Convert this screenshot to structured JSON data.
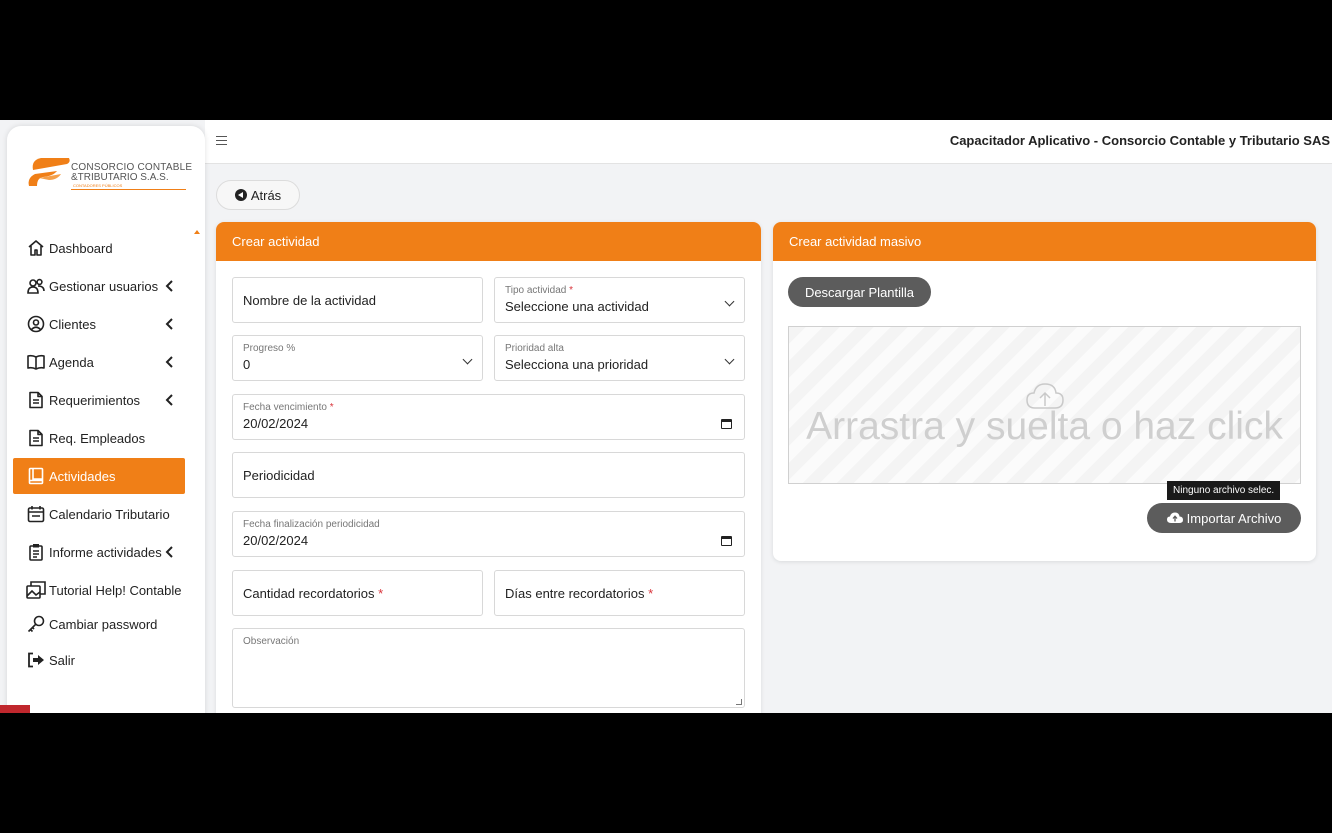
{
  "app": {
    "title": "Capacitador Aplicativo - Consorcio Contable y Tributario SAS"
  },
  "logo": {
    "line1": "CONSORCIO CONTABLE",
    "line2": "&TRIBUTARIO S.A.S.",
    "line3": "CONTADORES PÚBLICOS"
  },
  "sidebar": {
    "items": [
      {
        "label": "Dashboard",
        "icon": "home-icon",
        "has_chevron": false,
        "active": false
      },
      {
        "label": "Gestionar usuarios",
        "icon": "users-icon",
        "has_chevron": true,
        "active": false
      },
      {
        "label": "Clientes",
        "icon": "user-circle-icon",
        "has_chevron": true,
        "active": false
      },
      {
        "label": "Agenda",
        "icon": "book-open-icon",
        "has_chevron": true,
        "active": false
      },
      {
        "label": "Requerimientos",
        "icon": "document-icon",
        "has_chevron": true,
        "active": false
      },
      {
        "label": "Req. Empleados",
        "icon": "document-icon",
        "has_chevron": false,
        "active": false
      },
      {
        "label": "Actividades",
        "icon": "book-icon",
        "has_chevron": false,
        "active": true
      },
      {
        "label": "Calendario Tributario",
        "icon": "calendar-icon",
        "has_chevron": false,
        "active": false
      },
      {
        "label": "Informe actividades",
        "icon": "report-icon",
        "has_chevron": true,
        "active": false
      },
      {
        "label": "Tutorial Help! Contable",
        "icon": "images-icon",
        "has_chevron": false,
        "active": false
      },
      {
        "label": "Cambiar password",
        "icon": "key-icon",
        "has_chevron": false,
        "active": false
      },
      {
        "label": "Salir",
        "icon": "logout-icon",
        "has_chevron": false,
        "active": false
      }
    ]
  },
  "back_button": {
    "label": "Atrás"
  },
  "create_form": {
    "header": "Crear actividad",
    "nombre_placeholder": "Nombre de la actividad",
    "tipo_label": "Tipo actividad",
    "tipo_value": "Seleccione una actividad",
    "progreso_label": "Progreso %",
    "progreso_value": "0",
    "prioridad_label": "Prioridad alta",
    "prioridad_value": "Selecciona una prioridad",
    "fecha_venc_label": "Fecha vencimiento",
    "fecha_venc_value": "20/02/2024",
    "periodicidad_placeholder": "Periodicidad",
    "fecha_fin_label": "Fecha finalización periodicidad",
    "fecha_fin_value": "20/02/2024",
    "cantidad_placeholder": "Cantidad recordatorios",
    "dias_placeholder": "Días entre recordatorios",
    "observacion_label": "Observación",
    "required_mark": "*"
  },
  "bulk": {
    "header": "Crear actividad masivo",
    "download_label": "Descargar Plantilla",
    "dropzone_text": "Arrastra y suelta o haz click",
    "tooltip": "Ninguno archivo selec.",
    "import_label": "Importar Archivo"
  },
  "colors": {
    "accent": "#f07f17",
    "button_dark": "#5c5c5c",
    "required": "#d9343b"
  }
}
